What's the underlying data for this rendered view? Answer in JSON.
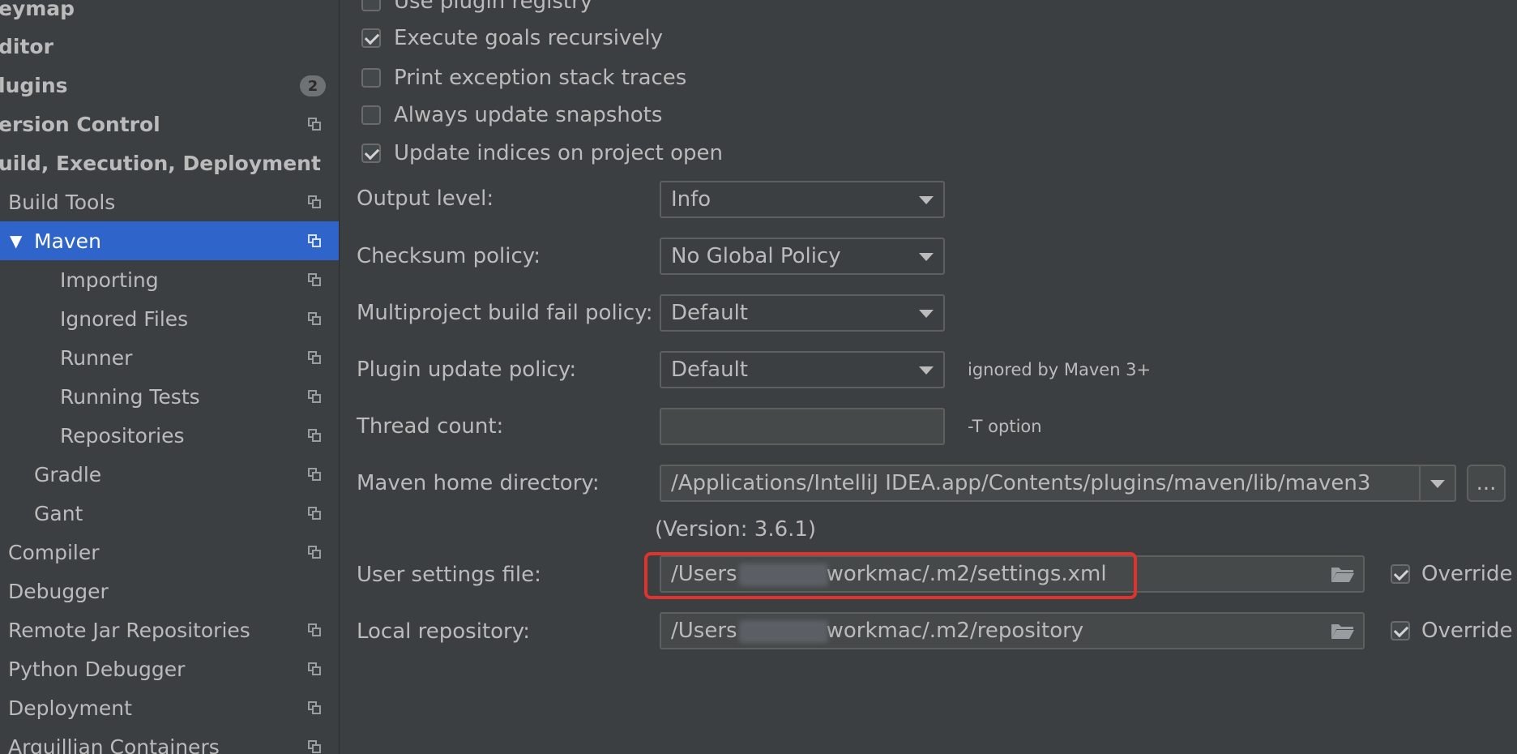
{
  "sidebar": {
    "items": [
      {
        "label": "eymap"
      },
      {
        "label": "ditor"
      },
      {
        "label": "lugins",
        "badge": "2"
      },
      {
        "label": "ersion Control"
      },
      {
        "label": "uild, Execution, Deployment"
      },
      {
        "label": "Build Tools"
      },
      {
        "label": "Maven",
        "expanded": true,
        "selected": true
      },
      {
        "label": "Importing"
      },
      {
        "label": "Ignored Files"
      },
      {
        "label": "Runner"
      },
      {
        "label": "Running Tests"
      },
      {
        "label": "Repositories"
      },
      {
        "label": "Gradle"
      },
      {
        "label": "Gant"
      },
      {
        "label": "Compiler"
      },
      {
        "label": "Debugger"
      },
      {
        "label": "Remote Jar Repositories"
      },
      {
        "label": "Python Debugger"
      },
      {
        "label": "Deployment"
      },
      {
        "label": "Arquillian Containers"
      }
    ]
  },
  "checkboxes": [
    {
      "label": "Use plugin registry",
      "checked": false
    },
    {
      "label": "Execute goals recursively",
      "checked": true
    },
    {
      "label": "Print exception stack traces",
      "checked": false
    },
    {
      "label": "Always update snapshots",
      "checked": false
    },
    {
      "label": "Update indices on project open",
      "checked": true
    }
  ],
  "form": {
    "output_level": {
      "label": "Output level:",
      "value": "Info"
    },
    "checksum_policy": {
      "label": "Checksum policy:",
      "value": "No Global Policy"
    },
    "multiproject_fail_policy": {
      "label": "Multiproject build fail policy:",
      "value": "Default"
    },
    "plugin_update_policy": {
      "label": "Plugin update policy:",
      "value": "Default",
      "hint": "ignored by Maven 3+"
    },
    "thread_count": {
      "label": "Thread count:",
      "value": "",
      "hint": "-T option"
    },
    "maven_home": {
      "label": "Maven home directory:",
      "value": "/Applications/IntelliJ IDEA.app/Contents/plugins/maven/lib/maven3",
      "browse_label": "...",
      "version": "(Version: 3.6.1)"
    },
    "user_settings": {
      "label": "User settings file:",
      "value_prefix": "/Users",
      "value_suffix": "workmac/.m2/settings.xml",
      "override_label": "Override",
      "override_checked": true
    },
    "local_repository": {
      "label": "Local repository:",
      "value_prefix": "/Users",
      "value_suffix": "workmac/.m2/repository",
      "override_label": "Override",
      "override_checked": true
    }
  },
  "colors": {
    "background": "#3c3f41",
    "selection": "#2f65ca",
    "highlight_box": "#e0332d"
  }
}
